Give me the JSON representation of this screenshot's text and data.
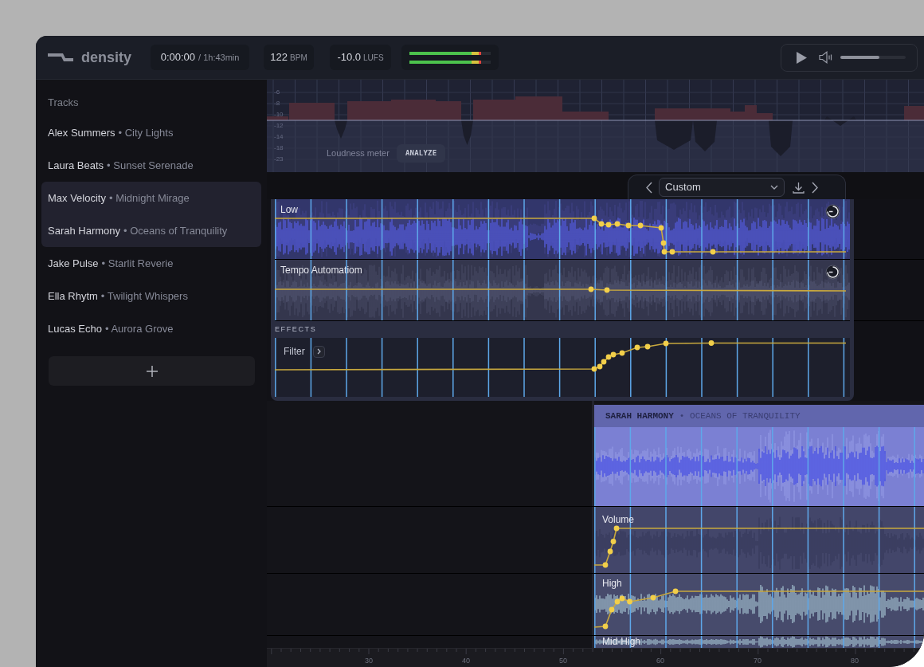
{
  "app": {
    "name": "density"
  },
  "toolbar": {
    "time": {
      "current": "0:00:00",
      "total": "/ 1h:43min"
    },
    "tempo": {
      "value": "122",
      "unit": "BPM"
    },
    "loudness": {
      "value": "-10.0",
      "unit": "LUFS"
    },
    "level_meter": {
      "channels": [
        {
          "level": 0.88
        },
        {
          "level": 0.88
        }
      ]
    },
    "volume": {
      "level": 0.6
    }
  },
  "sidebar": {
    "heading": "Tracks",
    "tracks": [
      {
        "artist": "Alex Summers",
        "title": "• City Lights",
        "selected": false
      },
      {
        "artist": "Laura Beats",
        "title": "• Sunset Serenade",
        "selected": false
      },
      {
        "artist": "Max Velocity",
        "title": "• Midnight Mirage",
        "selected": true
      },
      {
        "artist": "Sarah Harmony",
        "title": "• Oceans of Tranquility",
        "selected": true
      },
      {
        "artist": "Jake Pulse",
        "title": "• Starlit Reverie",
        "selected": false
      },
      {
        "artist": "Ella Rhytm",
        "title": "• Twilight Whispers",
        "selected": false
      },
      {
        "artist": "Lucas Echo",
        "title": "• Aurora Grove",
        "selected": false
      }
    ]
  },
  "loudness_meter": {
    "scale": [
      "-6",
      "-8",
      "-10",
      "-12",
      "-14",
      "-18",
      "-23"
    ],
    "label": "Loudness meter",
    "button": "ANALYZE"
  },
  "preset": {
    "value": "Custom"
  },
  "automation": {
    "lanes": [
      {
        "label": "Low",
        "kind": "band"
      },
      {
        "label": "Tempo Automatiom",
        "kind": "tempo"
      }
    ],
    "effects": {
      "heading": "EFFECTS",
      "items": [
        {
          "label": "Filter"
        }
      ]
    }
  },
  "clip": {
    "artist": "SARAH HARMONY",
    "title": "• OCEANS OF TRANQUILITY",
    "lanes": [
      {
        "label": "Volume",
        "kind": "volume"
      },
      {
        "label": "High",
        "kind": "high"
      },
      {
        "label": "Mid-High",
        "kind": "high"
      }
    ]
  },
  "ruler": {
    "labels": [
      "30",
      "40",
      "50",
      "60",
      "70",
      "80"
    ]
  }
}
